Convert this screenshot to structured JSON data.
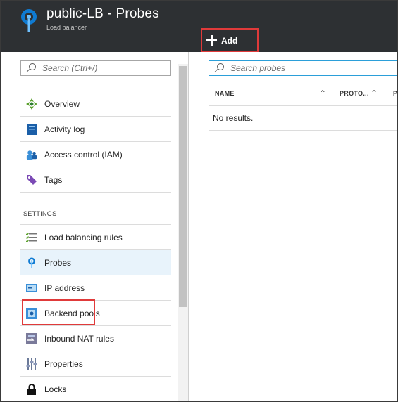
{
  "header": {
    "title": "public-LB - Probes",
    "subtitle": "Load balancer",
    "add_label": "Add",
    "bg_color": "#2d3033"
  },
  "left_panel": {
    "search_placeholder": "Search (Ctrl+/)",
    "items": [
      {
        "label": "Overview",
        "icon": "overview-icon"
      },
      {
        "label": "Activity log",
        "icon": "activity-log-icon"
      },
      {
        "label": "Access control (IAM)",
        "icon": "access-control-icon"
      },
      {
        "label": "Tags",
        "icon": "tag-icon"
      }
    ],
    "settings_header": "SETTINGS",
    "settings_items": [
      {
        "label": "Load balancing rules",
        "icon": "load-balancing-rules-icon"
      },
      {
        "label": "Probes",
        "icon": "probe-icon",
        "selected": true
      },
      {
        "label": "IP address",
        "icon": "ip-address-icon"
      },
      {
        "label": "Backend pools",
        "icon": "backend-pools-icon"
      },
      {
        "label": "Inbound NAT rules",
        "icon": "inbound-nat-rules-icon"
      },
      {
        "label": "Properties",
        "icon": "properties-icon"
      },
      {
        "label": "Locks",
        "icon": "lock-icon"
      }
    ]
  },
  "right_panel": {
    "search_placeholder": "Search probes",
    "columns": [
      "NAME",
      "PROTO...",
      "PO"
    ],
    "empty_text": "No results."
  },
  "colors": {
    "accent": "#2b9fd9",
    "highlight": "#e03a3a",
    "selected_bg": "#e8f3fb"
  }
}
